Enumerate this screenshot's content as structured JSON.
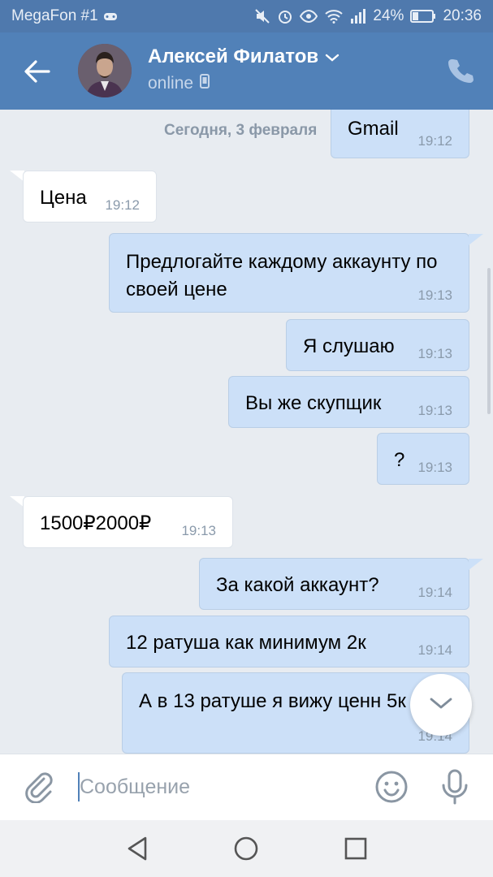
{
  "status_bar": {
    "carrier": "MegaFon #1",
    "battery": "24%",
    "time": "20:36"
  },
  "header": {
    "name": "Алексей Филатов",
    "status": "online"
  },
  "chat": {
    "date_separator": "Сегодня, 3 февраля",
    "messages": [
      {
        "dir": "out",
        "text": "Gmail",
        "time": "19:12"
      },
      {
        "dir": "in",
        "text": "Цена",
        "time": "19:12"
      },
      {
        "dir": "out",
        "text": "Предлогайте каждому аккаунту по своей цене",
        "time": "19:13"
      },
      {
        "dir": "out",
        "text": "Я слушаю",
        "time": "19:13"
      },
      {
        "dir": "out",
        "text": "Вы же скупщик",
        "time": "19:13"
      },
      {
        "dir": "out",
        "text": "?",
        "time": "19:13"
      },
      {
        "dir": "in",
        "text": "1500₽2000₽",
        "time": "19:13"
      },
      {
        "dir": "out",
        "text": "За какой аккаунт?",
        "time": "19:14"
      },
      {
        "dir": "out",
        "text": "12 ратуша как минимум 2к",
        "time": "19:14"
      },
      {
        "dir": "out",
        "text": "А в 13 ратуше я вижу ценн 5к",
        "time": "19:14"
      }
    ]
  },
  "input": {
    "placeholder": "Сообщение"
  },
  "icons": {
    "back": "arrow-left-icon",
    "phone": "phone-icon",
    "attach": "paperclip-icon",
    "emoji": "smile-icon",
    "mic": "microphone-icon",
    "scroll_down": "chevron-down-icon"
  },
  "colors": {
    "header": "#5181b8",
    "status_bar": "#4f79ad",
    "out_bubble": "#cce0f8",
    "in_bubble": "#ffffff",
    "chat_bg": "#e8ecf1"
  }
}
